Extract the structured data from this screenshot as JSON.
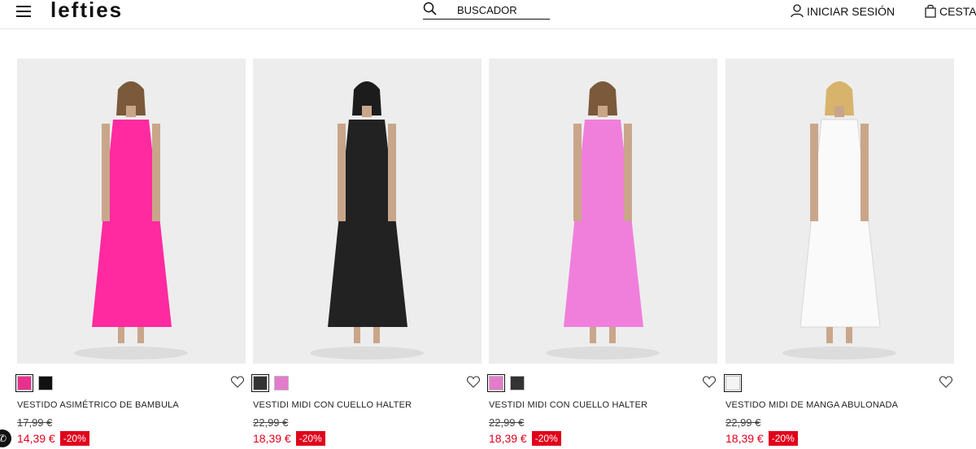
{
  "header": {
    "logo": "lefties",
    "search_label": "BUSCADOR",
    "login_label": "INICIAR SESIÓN",
    "cart_label": "CESTA"
  },
  "products": [
    {
      "name": "VESTIDO ASIMÉTRICO DE BAMBULA",
      "old_price": "17,99 €",
      "price": "14,39 €",
      "discount": "-20%",
      "dress_color": "#ff2aa0",
      "swatches": [
        "#e8308e",
        "#111111"
      ]
    },
    {
      "name": "VESTIDI MIDI CON CUELLO HALTER",
      "old_price": "22,99 €",
      "price": "18,39 €",
      "discount": "-20%",
      "dress_color": "#222222",
      "swatches": [
        "#333333",
        "#e37ccb"
      ]
    },
    {
      "name": "VESTIDI MIDI CON CUELLO HALTER",
      "old_price": "22,99 €",
      "price": "18,39 €",
      "discount": "-20%",
      "dress_color": "#f07fdc",
      "swatches": [
        "#e37ccb",
        "#333333"
      ]
    },
    {
      "name": "VESTIDO MIDI DE MANGA ABULONADA",
      "old_price": "22,99 €",
      "price": "18,39 €",
      "discount": "-20%",
      "dress_color": "#fafafa",
      "swatches": [
        "#f4f4f4"
      ]
    }
  ],
  "colors": {
    "accent": "#e0001b"
  }
}
